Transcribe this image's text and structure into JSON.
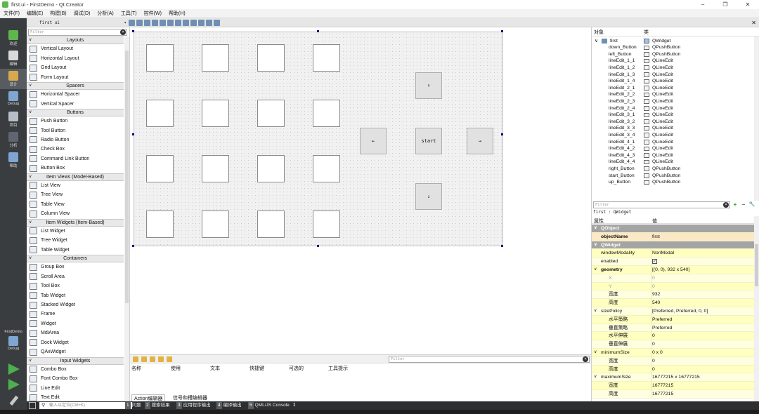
{
  "window": {
    "title": "first.ui - FirstDemo - Qt Creator",
    "minimize": "–",
    "maximize": "❐",
    "close": "✕"
  },
  "menubar": [
    "文件(F)",
    "编辑(E)",
    "构建(B)",
    "调试(D)",
    "分析(A)",
    "工具(T)",
    "控件(W)",
    "帮助(H)"
  ],
  "modes": [
    {
      "label": "欢迎",
      "color": "#5db84c"
    },
    {
      "label": "编辑",
      "color": "#d9d9d9"
    },
    {
      "label": "设计",
      "color": "#d9a84c"
    },
    {
      "label": "Debug",
      "color": "#7fa6d1"
    },
    {
      "label": "项目",
      "color": "#b8bec6"
    },
    {
      "label": "分析",
      "color": "#5f6670"
    },
    {
      "label": "帮助",
      "color": "#7fa6d1"
    }
  ],
  "kit": {
    "project": "FirstDemo",
    "mode": "Debug"
  },
  "editor": {
    "file": "first ui",
    "arrow": "▾"
  },
  "widgetbox": {
    "filter_placeholder": "Filter",
    "clear": "×",
    "entries": [
      {
        "cat": "Layouts"
      },
      {
        "item": "Vertical Layout"
      },
      {
        "item": "Horizontal Layout"
      },
      {
        "item": "Grid Layout"
      },
      {
        "item": "Form Layout"
      },
      {
        "cat": "Spacers"
      },
      {
        "item": "Horizontal Spacer"
      },
      {
        "item": "Vertical Spacer"
      },
      {
        "cat": "Buttons"
      },
      {
        "item": "Push Button"
      },
      {
        "item": "Tool Button"
      },
      {
        "item": "Radio Button"
      },
      {
        "item": "Check Box"
      },
      {
        "item": "Command Link Button"
      },
      {
        "item": "Button Box"
      },
      {
        "cat": "Item Views (Model-Based)"
      },
      {
        "item": "List View"
      },
      {
        "item": "Tree View"
      },
      {
        "item": "Table View"
      },
      {
        "item": "Column View"
      },
      {
        "cat": "Item Widgets (Item-Based)"
      },
      {
        "item": "List Widget"
      },
      {
        "item": "Tree Widget"
      },
      {
        "item": "Table Widget"
      },
      {
        "cat": "Containers"
      },
      {
        "item": "Group Box"
      },
      {
        "item": "Scroll Area"
      },
      {
        "item": "Tool Box"
      },
      {
        "item": "Tab Widget"
      },
      {
        "item": "Stacked Widget"
      },
      {
        "item": "Frame"
      },
      {
        "item": "Widget"
      },
      {
        "item": "MdiArea"
      },
      {
        "item": "Dock Widget"
      },
      {
        "item": "QAxWidget"
      },
      {
        "cat": "Input Widgets"
      },
      {
        "item": "Combo Box"
      },
      {
        "item": "Font Combo Box"
      },
      {
        "item": "Line Edit"
      },
      {
        "item": "Text Edit"
      }
    ]
  },
  "form": {
    "buttons": {
      "up": "↑",
      "left": "←",
      "start": "start",
      "right": "→",
      "down": "↓"
    }
  },
  "action_editor": {
    "filter_placeholder": "Filter",
    "clear": "×",
    "columns": [
      "名称",
      "使用",
      "文本",
      "快捷键",
      "可选的",
      "工具提示"
    ],
    "tabs": [
      "Action编辑器",
      "信号和槽编辑器"
    ]
  },
  "statusbar": {
    "locator_placeholder": "输入以定位(Ctrl+K)",
    "tabs": [
      {
        "num": "1",
        "label": "问题"
      },
      {
        "num": "2",
        "label": "搜索结果"
      },
      {
        "num": "3",
        "label": "应用程序输出"
      },
      {
        "num": "4",
        "label": "编译输出"
      },
      {
        "num": "5",
        "label": "QML/JS Console"
      }
    ]
  },
  "object_inspector": {
    "col_object": "对象",
    "col_class": "类",
    "rows": [
      {
        "name": "first",
        "cls": "QWidget",
        "root": true
      },
      {
        "name": "down_Button",
        "cls": "QPushButton"
      },
      {
        "name": "left_Button",
        "cls": "QPushButton"
      },
      {
        "name": "lineEdit_1_1",
        "cls": "QLineEdit"
      },
      {
        "name": "lineEdit_1_2",
        "cls": "QLineEdit"
      },
      {
        "name": "lineEdit_1_3",
        "cls": "QLineEdit"
      },
      {
        "name": "lineEdit_1_4",
        "cls": "QLineEdit"
      },
      {
        "name": "lineEdit_2_1",
        "cls": "QLineEdit"
      },
      {
        "name": "lineEdit_2_2",
        "cls": "QLineEdit"
      },
      {
        "name": "lineEdit_2_3",
        "cls": "QLineEdit"
      },
      {
        "name": "lineEdit_2_4",
        "cls": "QLineEdit"
      },
      {
        "name": "lineEdit_3_1",
        "cls": "QLineEdit"
      },
      {
        "name": "lineEdit_3_2",
        "cls": "QLineEdit"
      },
      {
        "name": "lineEdit_3_3",
        "cls": "QLineEdit"
      },
      {
        "name": "lineEdit_3_4",
        "cls": "QLineEdit"
      },
      {
        "name": "lineEdit_4_1",
        "cls": "QLineEdit"
      },
      {
        "name": "lineEdit_4_2",
        "cls": "QLineEdit"
      },
      {
        "name": "lineEdit_4_3",
        "cls": "QLineEdit"
      },
      {
        "name": "lineEdit_4_4",
        "cls": "QLineEdit"
      },
      {
        "name": "right_Button",
        "cls": "QPushButton"
      },
      {
        "name": "start_Button",
        "cls": "QPushButton"
      },
      {
        "name": "up_Button",
        "cls": "QPushButton"
      }
    ]
  },
  "property_editor": {
    "filter_placeholder": "Filter",
    "clear": "×",
    "add": "+",
    "remove": "−",
    "configure": "🔧",
    "context": "first : QWidget",
    "col_property": "属性",
    "col_value": "值",
    "rows": [
      {
        "name": "QObject",
        "type": "section"
      },
      {
        "name": "objectName",
        "value": "first",
        "type": "sel"
      },
      {
        "name": "QWidget",
        "type": "section"
      },
      {
        "name": "windowModality",
        "value": "NonModal"
      },
      {
        "name": "enabled",
        "value": "☑",
        "check": true
      },
      {
        "name": "geometry",
        "value": "[(0, 0), 932 x 540]",
        "expand": true,
        "bold": true
      },
      {
        "name": "X",
        "value": "0",
        "sub": true,
        "dim": true
      },
      {
        "name": "Y",
        "value": "0",
        "sub": true,
        "dim": true
      },
      {
        "name": "宽度",
        "value": "932",
        "sub": true
      },
      {
        "name": "高度",
        "value": "540",
        "sub": true
      },
      {
        "name": "sizePolicy",
        "value": "[Preferred, Preferred, 0, 0]",
        "expand": true
      },
      {
        "name": "水平策略",
        "value": "Preferred",
        "sub": true
      },
      {
        "name": "垂直策略",
        "value": "Preferred",
        "sub": true
      },
      {
        "name": "水平伸展",
        "value": "0",
        "sub": true
      },
      {
        "name": "垂直伸展",
        "value": "0",
        "sub": true
      },
      {
        "name": "minimumSize",
        "value": "0 x 0",
        "expand": true
      },
      {
        "name": "宽度",
        "value": "0",
        "sub": true
      },
      {
        "name": "高度",
        "value": "0",
        "sub": true
      },
      {
        "name": "maximumSize",
        "value": "16777215 x 16777215",
        "expand": true
      },
      {
        "name": "宽度",
        "value": "16777215",
        "sub": true
      },
      {
        "name": "高度",
        "value": "16777215",
        "sub": true
      }
    ]
  },
  "colors": {
    "accent": "#000080",
    "modebar": "#3a3d40",
    "section": "#a4a4a4",
    "yellow": "#ffffe0"
  }
}
